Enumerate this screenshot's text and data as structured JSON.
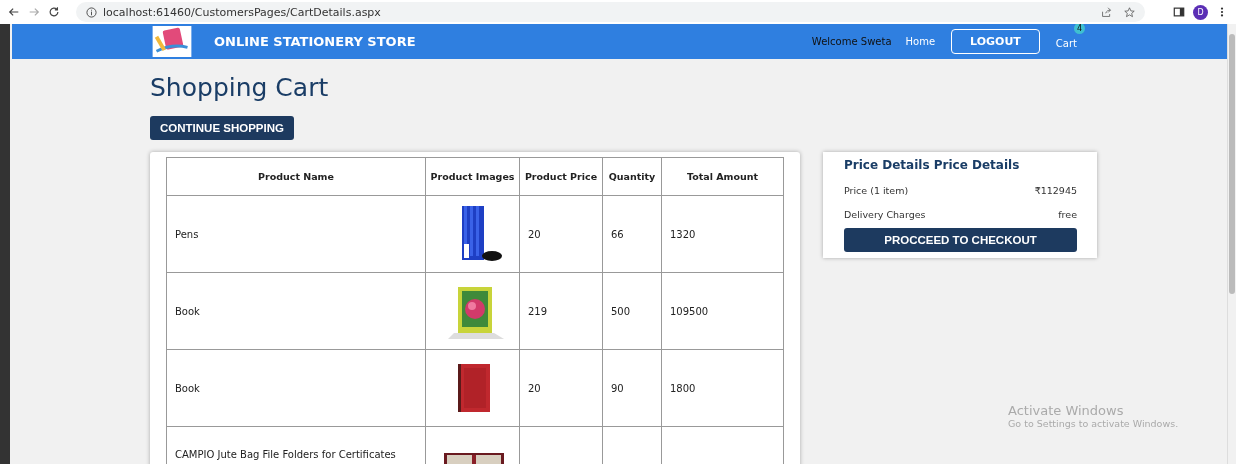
{
  "browser": {
    "url": "localhost:61460/CustomersPages/CartDetails.aspx",
    "profile_initial": "D"
  },
  "navbar": {
    "brand": "ONLINE STATIONERY STORE",
    "welcome": "Welcome Sweta",
    "home": "Home",
    "logout": "LOGOUT",
    "cart": "Cart",
    "cart_count": "4"
  },
  "page": {
    "title": "Shopping Cart",
    "continue_button": "CONTINUE SHOPPING"
  },
  "table": {
    "columns": [
      "Product Name",
      "Product Images",
      "Product Price",
      "Quantity",
      "Total Amount"
    ],
    "rows": [
      {
        "name": "Pens",
        "price": "20",
        "quantity": "66",
        "total": "1320"
      },
      {
        "name": "Book",
        "price": "219",
        "quantity": "500",
        "total": "109500"
      },
      {
        "name": "Book",
        "price": "20",
        "quantity": "90",
        "total": "1800"
      },
      {
        "name": "CAMPIO Jute Bag File Folders for Certificates"
      }
    ]
  },
  "price_details": {
    "title": "Price Details Price Details",
    "rows": [
      {
        "label": "Price (1 item)",
        "value": "₹112945"
      },
      {
        "label": "Delivery Charges",
        "value": "free"
      }
    ],
    "checkout_button": "PROCCEED TO CHECKOUT"
  },
  "os_notice": {
    "title": "Activate Windows",
    "subtitle": "Go to Settings to activate Windows."
  }
}
